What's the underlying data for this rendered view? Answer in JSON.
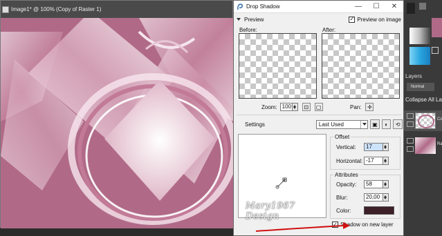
{
  "image_window": {
    "title": "Image1* @ 100% (Copy of Raster 1)",
    "buttons": [
      "–",
      "□",
      "✕"
    ]
  },
  "dialog": {
    "title": "Drop Shadow",
    "title_buttons": {
      "minimize": "—",
      "maximize": "☐",
      "close": "✕"
    },
    "preview_label": "Preview",
    "preview_on_image_label": "Preview on image",
    "preview_on_image_checked": true,
    "before_label": "Before:",
    "after_label": "After:",
    "zoom_label": "Zoom:",
    "zoom_value": "100",
    "pan_label": "Pan:",
    "settings_label": "Settings",
    "settings_value": "Last Used",
    "offset_label": "Offset",
    "vertical_label": "Vertical:",
    "vertical_value": "17",
    "horizontal_label": "Horizontal:",
    "horizontal_value": "-17",
    "attributes_label": "Attributes",
    "opacity_label": "Opacity:",
    "opacity_value": "58",
    "blur_label": "Blur:",
    "blur_value": "20,00",
    "color_label": "Color:",
    "shadow_color": "#3d2028",
    "shadow_on_new_layer_label": "Shadow on new layer",
    "shadow_on_new_layer_checked": true,
    "watermark": "Mary1967 Design"
  },
  "right_panel": {
    "layers_label": "Layers",
    "blend_mode": "Normal",
    "collapse_label": "Collapse All Layers",
    "layer_1_name": "Co",
    "layer_2_name": "Ra"
  },
  "colors": {
    "canvas_pink": "#b06a88",
    "annotation_red": "#d01010"
  }
}
